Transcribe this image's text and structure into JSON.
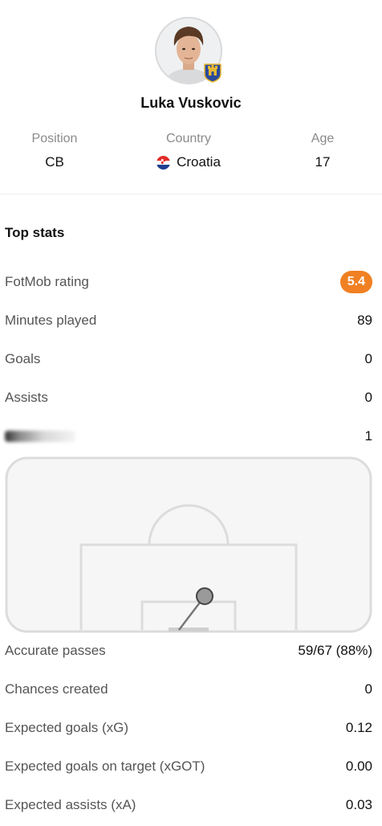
{
  "player": {
    "name": "Luka Vuskovic",
    "info": [
      {
        "label": "Position",
        "value": "CB"
      },
      {
        "label": "Country",
        "value": "Croatia"
      },
      {
        "label": "Age",
        "value": "17"
      }
    ]
  },
  "top_stats": {
    "title": "Top stats",
    "rows": [
      {
        "label": "FotMob rating",
        "value": "5.4",
        "accent": "#f08022"
      },
      {
        "label": "Minutes played",
        "value": "89"
      },
      {
        "label": "Goals",
        "value": "0"
      },
      {
        "label": "Assists",
        "value": "0"
      },
      {
        "label": "",
        "value": "1"
      }
    ]
  },
  "pass_stats": {
    "rows": [
      {
        "label": "Accurate passes",
        "value": "59/67 (88%)"
      },
      {
        "label": "Chances created",
        "value": "0"
      },
      {
        "label": "Expected goals (xG)",
        "value": "0.12"
      },
      {
        "label": "Expected goals on target (xGOT)",
        "value": "0.00"
      },
      {
        "label": "Expected assists (xA)",
        "value": "0.03"
      }
    ]
  }
}
